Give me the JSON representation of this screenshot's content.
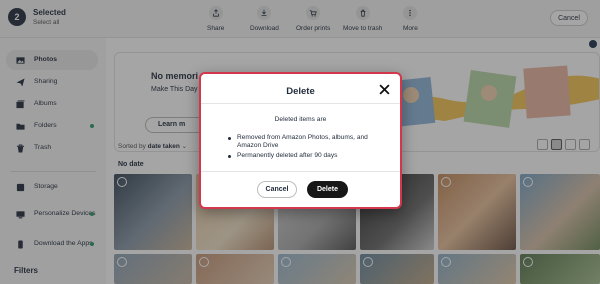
{
  "selection": {
    "count": "2",
    "title": "Selected",
    "select_all": "Select all"
  },
  "actions": [
    {
      "label": "Share",
      "icon": "share-icon"
    },
    {
      "label": "Download",
      "icon": "download-icon"
    },
    {
      "label": "Order prints",
      "icon": "cart-icon"
    },
    {
      "label": "Move to trash",
      "icon": "trash-icon"
    },
    {
      "label": "More",
      "icon": "more-icon"
    }
  ],
  "cancel_label": "Cancel",
  "sidebar": {
    "items": [
      {
        "label": "Photos",
        "icon": "photo-icon",
        "active": true
      },
      {
        "label": "Sharing",
        "icon": "send-icon"
      },
      {
        "label": "Albums",
        "icon": "album-icon"
      },
      {
        "label": "Folders",
        "icon": "folder-icon"
      },
      {
        "label": "Trash",
        "icon": "trash-icon"
      }
    ],
    "items2": [
      {
        "label": "Storage",
        "icon": "storage-icon"
      },
      {
        "label": "Personalize Devices",
        "icon": "devices-icon"
      },
      {
        "label": "Download the Apps",
        "icon": "phone-icon"
      }
    ],
    "filters_label": "Filters"
  },
  "banner": {
    "title": "No memori",
    "subtitle": "Make This Day o",
    "button": "Learn m"
  },
  "sort": {
    "prefix": "Sorted by",
    "value": "date taken"
  },
  "section_label": "No date",
  "dialog": {
    "title": "Delete",
    "lead": "Deleted items are",
    "bullets": [
      "Removed from Amazon Photos, albums, and Amazon Drive",
      "Permanently deleted after 90 days"
    ],
    "cancel": "Cancel",
    "confirm": "Delete"
  },
  "colors": {
    "accent": "#232f3e",
    "status_dot": "#2d9a6a",
    "dialog_border": "#d3374b"
  }
}
